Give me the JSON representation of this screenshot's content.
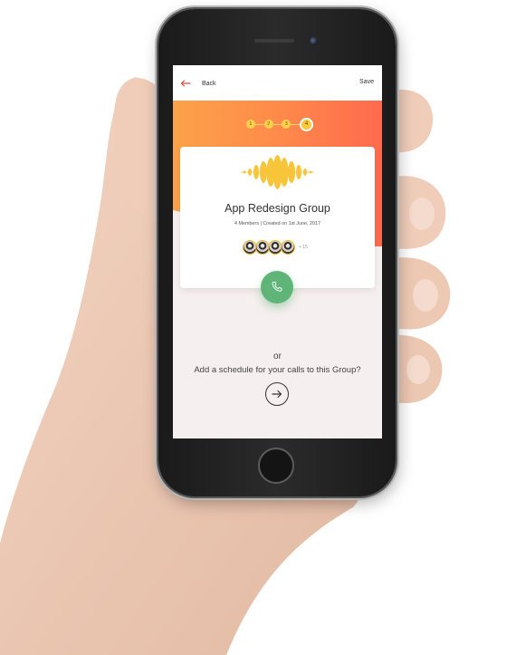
{
  "topbar": {
    "back_label": "Back",
    "save_label": "Save"
  },
  "steps": [
    {
      "label": "1",
      "active": false
    },
    {
      "label": "2",
      "active": false
    },
    {
      "label": "3",
      "active": false
    },
    {
      "label": "4",
      "active": true
    }
  ],
  "group": {
    "name": "App Redesign Group",
    "meta": "4 Members  |  Created on 1st June, 2017",
    "more_members": "+ 15"
  },
  "footer": {
    "or_label": "or",
    "schedule_label": "Add a schedule for your calls to this Group?"
  },
  "colors": {
    "accent_red": "#e8453c",
    "orange_start": "#fba24a",
    "orange_end": "#ff6a4f",
    "yellow": "#ffc83a",
    "call_green": "#5fb577"
  },
  "icons": [
    "back-arrow-icon",
    "soundwave-icon",
    "phone-icon",
    "arrow-right-icon"
  ]
}
